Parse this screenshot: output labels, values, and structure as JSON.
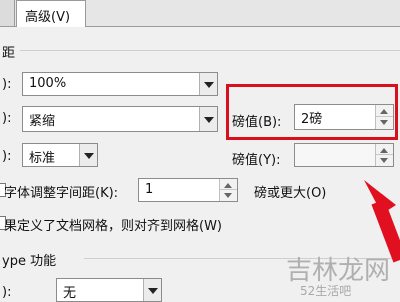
{
  "tabs": {
    "advanced": "高级(V)"
  },
  "section_label": "距",
  "row1": {
    "label": "):",
    "value": "100%"
  },
  "row2": {
    "label": "):",
    "value": "紧缩"
  },
  "row3": {
    "label": "):",
    "value": "标准"
  },
  "right_top": {
    "label": "磅值(B):",
    "value": "2磅"
  },
  "right_bottom": {
    "label": "磅值(Y):",
    "value": ""
  },
  "kerning": {
    "label": "字体调整字间距(K):",
    "value": "1",
    "suffix": "磅或更大(O)"
  },
  "grid_option": {
    "label": "果定义了文档网格，则对齐到网格(W)"
  },
  "opentype": {
    "heading": "ype 功能",
    "label": "):",
    "value": "无"
  },
  "watermark": {
    "main": "吉林龙网",
    "sub": "52生活吧"
  },
  "colors": {
    "highlight": "#d8101c",
    "arrow": "#e01020"
  }
}
